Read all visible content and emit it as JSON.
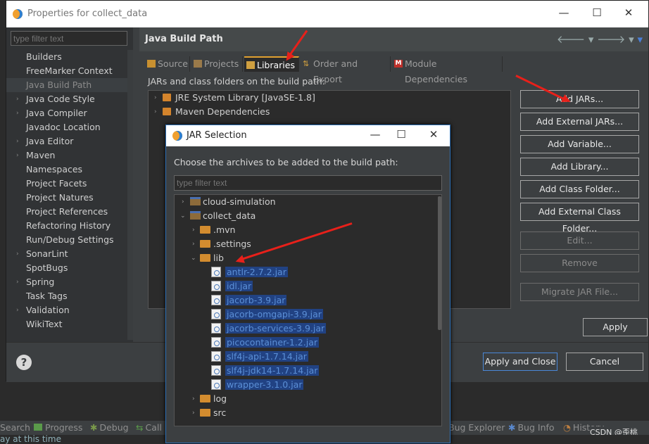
{
  "window": {
    "title": "Properties for collect_data",
    "controls": [
      "—",
      "☐",
      "✕"
    ]
  },
  "sidebar": {
    "filter_placeholder": "type filter text",
    "items": [
      {
        "label": "Builders",
        "expandable": false
      },
      {
        "label": "FreeMarker Context",
        "expandable": false
      },
      {
        "label": "Java Build Path",
        "expandable": false,
        "selected": true
      },
      {
        "label": "Java Code Style",
        "expandable": true
      },
      {
        "label": "Java Compiler",
        "expandable": true
      },
      {
        "label": "Javadoc Location",
        "expandable": false
      },
      {
        "label": "Java Editor",
        "expandable": true
      },
      {
        "label": "Maven",
        "expandable": true
      },
      {
        "label": "Namespaces",
        "expandable": false
      },
      {
        "label": "Project Facets",
        "expandable": false
      },
      {
        "label": "Project Natures",
        "expandable": false
      },
      {
        "label": "Project References",
        "expandable": false
      },
      {
        "label": "Refactoring History",
        "expandable": false
      },
      {
        "label": "Run/Debug Settings",
        "expandable": false
      },
      {
        "label": "SonarLint",
        "expandable": true
      },
      {
        "label": "SpotBugs",
        "expandable": false
      },
      {
        "label": "Spring",
        "expandable": true
      },
      {
        "label": "Task Tags",
        "expandable": false
      },
      {
        "label": "Validation",
        "expandable": true
      },
      {
        "label": "WikiText",
        "expandable": false
      }
    ]
  },
  "main": {
    "title": "Java Build Path",
    "tabs": [
      {
        "label": "Source",
        "active": false
      },
      {
        "label": "Projects",
        "active": false
      },
      {
        "label": "Libraries",
        "active": true
      },
      {
        "label": "Order and Export",
        "active": false
      },
      {
        "label": "Module Dependencies",
        "active": false
      }
    ],
    "libraries_hint": "JARs and class folders on the build path:",
    "tree": [
      "JRE System Library [JavaSE-1.8]",
      "Maven Dependencies"
    ],
    "buttons": {
      "add_jars": "Add JARs...",
      "add_external_jars": "Add External JARs...",
      "add_variable": "Add Variable...",
      "add_library": "Add Library...",
      "add_class_folder": "Add Class Folder...",
      "add_external_class_folder": "Add External Class Folder...",
      "edit": "Edit...",
      "remove": "Remove",
      "migrate": "Migrate JAR File...",
      "apply": "Apply"
    }
  },
  "footer": {
    "help": "?",
    "apply_and_close": "Apply and Close",
    "cancel": "Cancel"
  },
  "dialog": {
    "title": "JAR Selection",
    "controls": [
      "—",
      "☐",
      "✕"
    ],
    "message": "Choose the archives to be added to the build path:",
    "filter_placeholder": "type filter text",
    "tree": {
      "cloud_simulation": "cloud-simulation",
      "collect_data": "collect_data",
      "mvn": ".mvn",
      "settings": ".settings",
      "lib": "lib",
      "jars": [
        "antlr-2.7.2.jar",
        "idl.jar",
        "jacorb-3.9.jar",
        "jacorb-omgapi-3.9.jar",
        "jacorb-services-3.9.jar",
        "picocontainer-1.2.jar",
        "slf4j-api-1.7.14.jar",
        "slf4j-jdk14-1.7.14.jar",
        "wrapper-3.1.0.jar"
      ],
      "log": "log",
      "src": "src"
    }
  },
  "statusbar": {
    "items": [
      "Search",
      "Progress",
      "Debug",
      "Call",
      "Bug Explorer",
      "Bug Info",
      "History"
    ],
    "bottom_text": "ay at this time",
    "watermark": "CSDN @歪桃"
  }
}
